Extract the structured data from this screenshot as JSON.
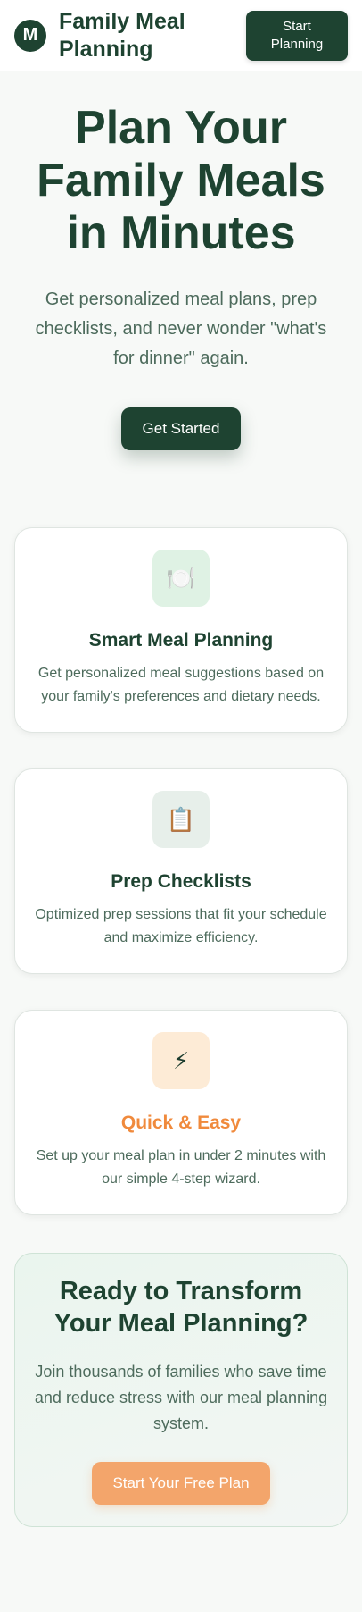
{
  "header": {
    "logo_letter": "M",
    "brand": "Family Meal Planning",
    "cta_label": "Start Planning"
  },
  "hero": {
    "title": "Plan Your Family Meals in Minutes",
    "subtitle": "Get personalized meal plans, prep checklists, and never wonder \"what's for dinner\" again.",
    "cta_label": "Get Started"
  },
  "features": [
    {
      "icon": "plate-icon",
      "glyph": "🍽️",
      "title": "Smart Meal Planning",
      "description": "Get personalized meal suggestions based on your family's preferences and dietary needs.",
      "icon_bg": "#dff2e4",
      "title_color": "#1e4331"
    },
    {
      "icon": "clipboard-icon",
      "glyph": "📋",
      "title": "Prep Checklists",
      "description": "Optimized prep sessions that fit your schedule and maximize efficiency.",
      "icon_bg": "#e7efea",
      "title_color": "#1e4331"
    },
    {
      "icon": "lightning-icon",
      "glyph": "⚡",
      "title": "Quick & Easy",
      "description": "Set up your meal plan in under 2 minutes with our simple 4-step wizard.",
      "icon_bg": "#fdebd6",
      "title_color": "#f08a3c"
    }
  ],
  "cta_section": {
    "title": "Ready to Transform Your Meal Planning?",
    "text": "Join thousands of families who save time and reduce stress with our meal planning system.",
    "button_label": "Start Your Free Plan"
  },
  "colors": {
    "primary": "#1e4331",
    "accent": "#f3a56b",
    "background": "#f7f9f7"
  }
}
